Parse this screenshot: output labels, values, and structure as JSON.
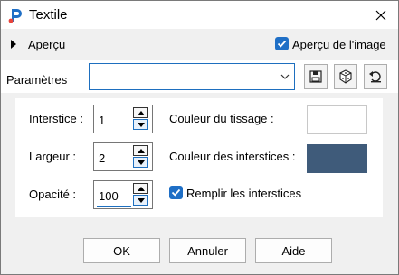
{
  "window": {
    "title": "Textile"
  },
  "preview": {
    "label": "Aperçu",
    "image_preview_label": "Aperçu de l'image",
    "image_preview_checked": true
  },
  "params": {
    "label": "Paramètres",
    "preset_value": ""
  },
  "toolbar": {
    "icons": [
      "save-icon",
      "dice-icon",
      "reset-icon"
    ]
  },
  "fields": {
    "interstice": {
      "label": "Interstice :",
      "value": "1"
    },
    "largeur": {
      "label": "Largeur :",
      "value": "2"
    },
    "opacite": {
      "label": "Opacité :",
      "value": "100"
    }
  },
  "colors": {
    "tissage_label": "Couleur du tissage :",
    "tissage_color": "#ffffff",
    "interstices_label": "Couleur des interstices :",
    "interstices_color": "#3f5b7a"
  },
  "remplir": {
    "label": "Remplir les interstices",
    "checked": true
  },
  "buttons": {
    "ok": "OK",
    "annuler": "Annuler",
    "aide": "Aide"
  },
  "accent": "#1f6fc6"
}
